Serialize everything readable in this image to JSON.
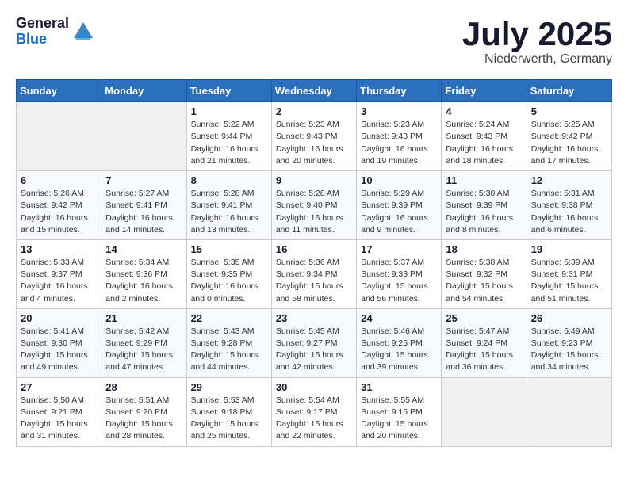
{
  "header": {
    "logo_general": "General",
    "logo_blue": "Blue",
    "month_title": "July 2025",
    "location": "Niederwerth, Germany"
  },
  "days_of_week": [
    "Sunday",
    "Monday",
    "Tuesday",
    "Wednesday",
    "Thursday",
    "Friday",
    "Saturday"
  ],
  "weeks": [
    [
      {
        "num": "",
        "info": ""
      },
      {
        "num": "",
        "info": ""
      },
      {
        "num": "1",
        "info": "Sunrise: 5:22 AM\nSunset: 9:44 PM\nDaylight: 16 hours and 21 minutes."
      },
      {
        "num": "2",
        "info": "Sunrise: 5:23 AM\nSunset: 9:43 PM\nDaylight: 16 hours and 20 minutes."
      },
      {
        "num": "3",
        "info": "Sunrise: 5:23 AM\nSunset: 9:43 PM\nDaylight: 16 hours and 19 minutes."
      },
      {
        "num": "4",
        "info": "Sunrise: 5:24 AM\nSunset: 9:43 PM\nDaylight: 16 hours and 18 minutes."
      },
      {
        "num": "5",
        "info": "Sunrise: 5:25 AM\nSunset: 9:42 PM\nDaylight: 16 hours and 17 minutes."
      }
    ],
    [
      {
        "num": "6",
        "info": "Sunrise: 5:26 AM\nSunset: 9:42 PM\nDaylight: 16 hours and 15 minutes."
      },
      {
        "num": "7",
        "info": "Sunrise: 5:27 AM\nSunset: 9:41 PM\nDaylight: 16 hours and 14 minutes."
      },
      {
        "num": "8",
        "info": "Sunrise: 5:28 AM\nSunset: 9:41 PM\nDaylight: 16 hours and 13 minutes."
      },
      {
        "num": "9",
        "info": "Sunrise: 5:28 AM\nSunset: 9:40 PM\nDaylight: 16 hours and 11 minutes."
      },
      {
        "num": "10",
        "info": "Sunrise: 5:29 AM\nSunset: 9:39 PM\nDaylight: 16 hours and 9 minutes."
      },
      {
        "num": "11",
        "info": "Sunrise: 5:30 AM\nSunset: 9:39 PM\nDaylight: 16 hours and 8 minutes."
      },
      {
        "num": "12",
        "info": "Sunrise: 5:31 AM\nSunset: 9:38 PM\nDaylight: 16 hours and 6 minutes."
      }
    ],
    [
      {
        "num": "13",
        "info": "Sunrise: 5:33 AM\nSunset: 9:37 PM\nDaylight: 16 hours and 4 minutes."
      },
      {
        "num": "14",
        "info": "Sunrise: 5:34 AM\nSunset: 9:36 PM\nDaylight: 16 hours and 2 minutes."
      },
      {
        "num": "15",
        "info": "Sunrise: 5:35 AM\nSunset: 9:35 PM\nDaylight: 16 hours and 0 minutes."
      },
      {
        "num": "16",
        "info": "Sunrise: 5:36 AM\nSunset: 9:34 PM\nDaylight: 15 hours and 58 minutes."
      },
      {
        "num": "17",
        "info": "Sunrise: 5:37 AM\nSunset: 9:33 PM\nDaylight: 15 hours and 56 minutes."
      },
      {
        "num": "18",
        "info": "Sunrise: 5:38 AM\nSunset: 9:32 PM\nDaylight: 15 hours and 54 minutes."
      },
      {
        "num": "19",
        "info": "Sunrise: 5:39 AM\nSunset: 9:31 PM\nDaylight: 15 hours and 51 minutes."
      }
    ],
    [
      {
        "num": "20",
        "info": "Sunrise: 5:41 AM\nSunset: 9:30 PM\nDaylight: 15 hours and 49 minutes."
      },
      {
        "num": "21",
        "info": "Sunrise: 5:42 AM\nSunset: 9:29 PM\nDaylight: 15 hours and 47 minutes."
      },
      {
        "num": "22",
        "info": "Sunrise: 5:43 AM\nSunset: 9:28 PM\nDaylight: 15 hours and 44 minutes."
      },
      {
        "num": "23",
        "info": "Sunrise: 5:45 AM\nSunset: 9:27 PM\nDaylight: 15 hours and 42 minutes."
      },
      {
        "num": "24",
        "info": "Sunrise: 5:46 AM\nSunset: 9:25 PM\nDaylight: 15 hours and 39 minutes."
      },
      {
        "num": "25",
        "info": "Sunrise: 5:47 AM\nSunset: 9:24 PM\nDaylight: 15 hours and 36 minutes."
      },
      {
        "num": "26",
        "info": "Sunrise: 5:49 AM\nSunset: 9:23 PM\nDaylight: 15 hours and 34 minutes."
      }
    ],
    [
      {
        "num": "27",
        "info": "Sunrise: 5:50 AM\nSunset: 9:21 PM\nDaylight: 15 hours and 31 minutes."
      },
      {
        "num": "28",
        "info": "Sunrise: 5:51 AM\nSunset: 9:20 PM\nDaylight: 15 hours and 28 minutes."
      },
      {
        "num": "29",
        "info": "Sunrise: 5:53 AM\nSunset: 9:18 PM\nDaylight: 15 hours and 25 minutes."
      },
      {
        "num": "30",
        "info": "Sunrise: 5:54 AM\nSunset: 9:17 PM\nDaylight: 15 hours and 22 minutes."
      },
      {
        "num": "31",
        "info": "Sunrise: 5:55 AM\nSunset: 9:15 PM\nDaylight: 15 hours and 20 minutes."
      },
      {
        "num": "",
        "info": ""
      },
      {
        "num": "",
        "info": ""
      }
    ]
  ]
}
